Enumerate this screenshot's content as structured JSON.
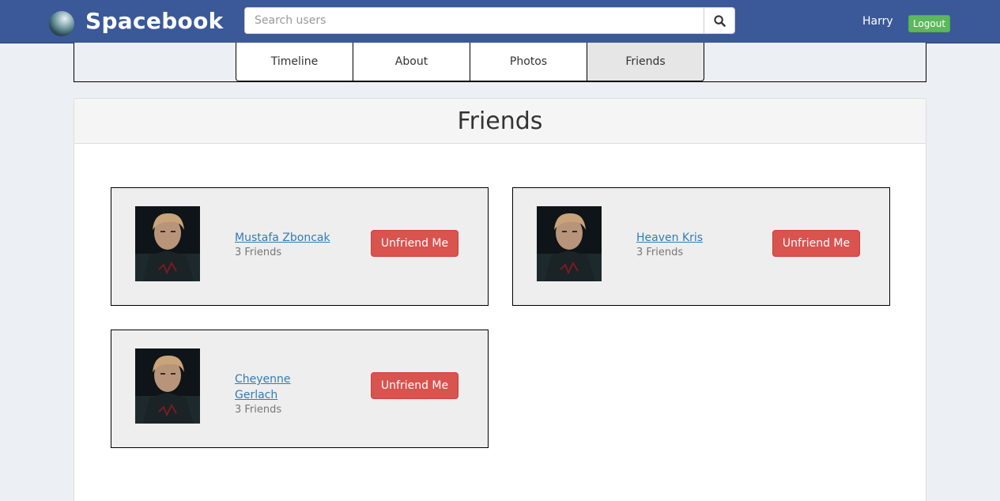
{
  "app": {
    "brand_name": "Spacebook",
    "logo_icon": "planet-icon",
    "accent_color": "#3b5998"
  },
  "search": {
    "placeholder": "Search users",
    "value": "",
    "button_icon": "search-icon"
  },
  "user": {
    "name": "Harry",
    "logout_label": "Logout"
  },
  "tabs": [
    {
      "label": "Timeline",
      "active": false
    },
    {
      "label": "About",
      "active": false
    },
    {
      "label": "Photos",
      "active": false
    },
    {
      "label": "Friends",
      "active": true
    }
  ],
  "panel": {
    "title": "Friends"
  },
  "friends": [
    {
      "name": "Mustafa Zboncak",
      "count": "3 Friends",
      "action_label": "Unfriend Me"
    },
    {
      "name": "Heaven Kris",
      "count": "3 Friends",
      "action_label": "Unfriend Me"
    },
    {
      "name": "Cheyenne Gerlach",
      "count": "3 Friends",
      "action_label": "Unfriend Me"
    }
  ],
  "colors": {
    "header_bg": "#3b5998",
    "logout_green": "#5cb85c",
    "unfriend_red": "#d9534f",
    "link_blue": "#337ab7"
  }
}
